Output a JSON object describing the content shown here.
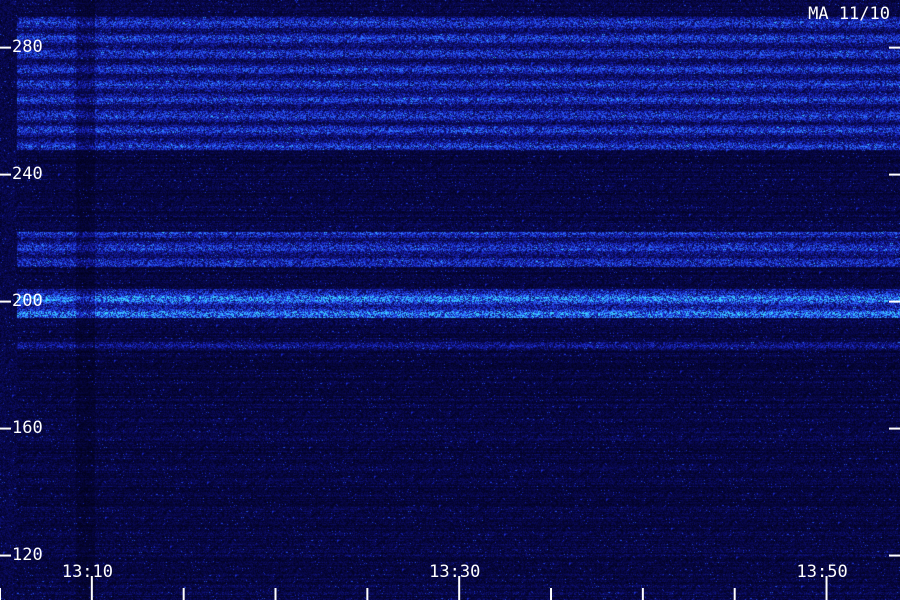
{
  "chart_data": {
    "type": "heatmap",
    "station_label": "MA 11/10",
    "y_ticks": [
      {
        "value": 280,
        "label": "280"
      },
      {
        "value": 240,
        "label": "240"
      },
      {
        "value": 200,
        "label": "200"
      },
      {
        "value": 160,
        "label": "160"
      },
      {
        "value": 120,
        "label": "120"
      }
    ],
    "y_range": [
      106,
      295
    ],
    "x_ticks": [
      {
        "minutes": 10,
        "label": "13:10"
      },
      {
        "minutes": 30,
        "label": "13:30"
      },
      {
        "minutes": 50,
        "label": "13:50"
      }
    ],
    "x_range_minutes": [
      5,
      54
    ],
    "minor_x_ticks_minutes": [
      5,
      10,
      15,
      20,
      25,
      30,
      35,
      40,
      45,
      50,
      55
    ],
    "bright_bands": [
      {
        "from": 248,
        "to": 290,
        "level": 0.55
      },
      {
        "from": 211,
        "to": 222,
        "level": 0.55
      },
      {
        "from": 195,
        "to": 204,
        "level": 0.8
      },
      {
        "from": 185,
        "to": 188,
        "level": 0.35
      }
    ],
    "colormap": [
      "#000010",
      "#0a0a5a",
      "#1a28c8",
      "#2e6cff",
      "#39d3ff"
    ]
  }
}
